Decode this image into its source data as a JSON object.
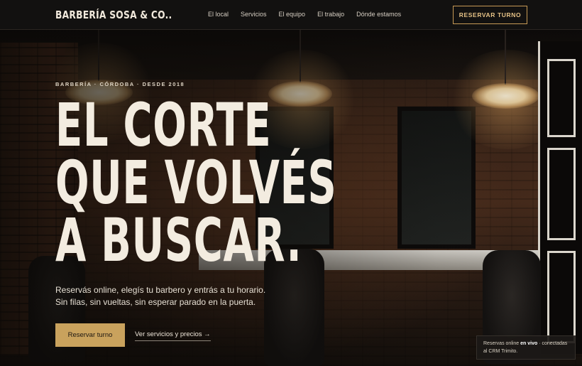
{
  "header": {
    "logo": "BARBERÍA SOSA & CO..",
    "nav": [
      {
        "label": "El local"
      },
      {
        "label": "Servicios"
      },
      {
        "label": "El equipo"
      },
      {
        "label": "El trabajo"
      },
      {
        "label": "Dónde estamos"
      }
    ],
    "cta": "RESERVAR TURNO"
  },
  "hero": {
    "eyebrow": "BARBERÍA · CÓRDOBA · DESDE 2018",
    "headline": [
      "EL CORTE",
      "QUE VOLVÉS",
      "A BUSCAR."
    ],
    "subtitle_line1": "Reservás online, elegís tu barbero y entrás a tu horario.",
    "subtitle_line2": "Sin filas, sin vueltas, sin esperar parado en la puerta.",
    "primary_button": "Reservar turno",
    "secondary_link": "Ver servicios y precios →"
  },
  "badge": {
    "prefix": "Reservas online ",
    "highlight": "en vivo",
    "suffix": " · conectadas",
    "line2": "al CRM Trimito."
  },
  "colors": {
    "accent": "#c9a25d",
    "header_bg": "#121110",
    "text": "#f3ece0"
  }
}
